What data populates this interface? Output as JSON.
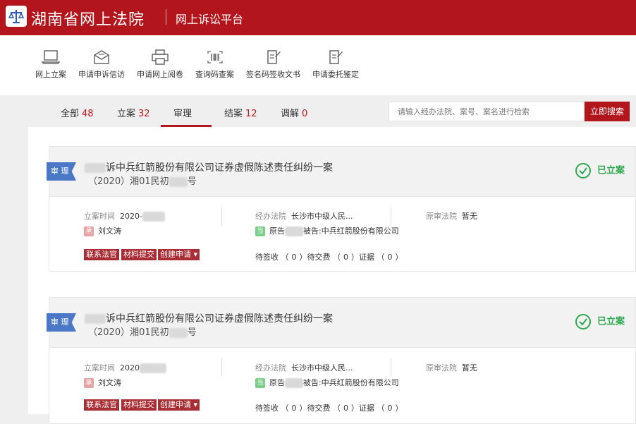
{
  "header": {
    "site_title": "湖南省网上法院",
    "platform": "网上诉讼平台"
  },
  "toolbar": [
    {
      "label": "网上立案",
      "icon": "laptop-icon"
    },
    {
      "label": "申请申诉信访",
      "icon": "letter-icon"
    },
    {
      "label": "申请网上阅卷",
      "icon": "printer-icon"
    },
    {
      "label": "查询码查案",
      "icon": "barcode-icon"
    },
    {
      "label": "签名码签收文书",
      "icon": "sign-document-icon"
    },
    {
      "label": "申请委托鉴定",
      "icon": "appraisal-document-icon"
    }
  ],
  "tabs": [
    {
      "label": "全部",
      "count": "48"
    },
    {
      "label": "立案",
      "count": "32"
    },
    {
      "label": "审理",
      "count": ""
    },
    {
      "label": "结案",
      "count": "12"
    },
    {
      "label": "调解",
      "count": "0"
    }
  ],
  "search": {
    "placeholder": "请输入经办法院、案号、案名进行检索",
    "button": "立即搜索"
  },
  "labels": {
    "badge": "审 理",
    "status": "已立案",
    "file_time": "立案时间",
    "handling_court": "经办法院",
    "original_court": "原审法院",
    "to_sign": "待签收",
    "to_pay": "待交费",
    "evidence": "证据",
    "contact_judge": "联系法官",
    "submit_material": "材料提交",
    "create_request": "创建申请",
    "judge_mark": "承",
    "party_mark": "当"
  },
  "colors": {
    "brand": "#b2161c",
    "badge": "#4a78c6",
    "status": "#2ea84f"
  },
  "cases": [
    {
      "title": "诉中兵红箭股份有限公司证券虚假陈述责任纠纷一案",
      "case_no_prefix": "（2020）湘01民初",
      "case_no_suffix": "号",
      "file_time": "2020-",
      "judge": "刘文涛",
      "court": "长沙市中级人民...",
      "original_court": "暂无",
      "party_prefix": "原告",
      "party_suffix": "被告:中兵红箭股份有限公司",
      "to_sign": "0",
      "to_pay": "0",
      "evidence": "0"
    },
    {
      "title": "诉中兵红箭股份有限公司证券虚假陈述责任纠纷一案",
      "case_no_prefix": "（2020）湘01民初",
      "case_no_suffix": "号",
      "file_time": "2020",
      "judge": "刘文涛",
      "court": "长沙市中级人民...",
      "original_court": "暂无",
      "party_prefix": "原告",
      "party_suffix": "被告:中兵红箭股份有限公司",
      "to_sign": "0",
      "to_pay": "0",
      "evidence": "0"
    }
  ]
}
